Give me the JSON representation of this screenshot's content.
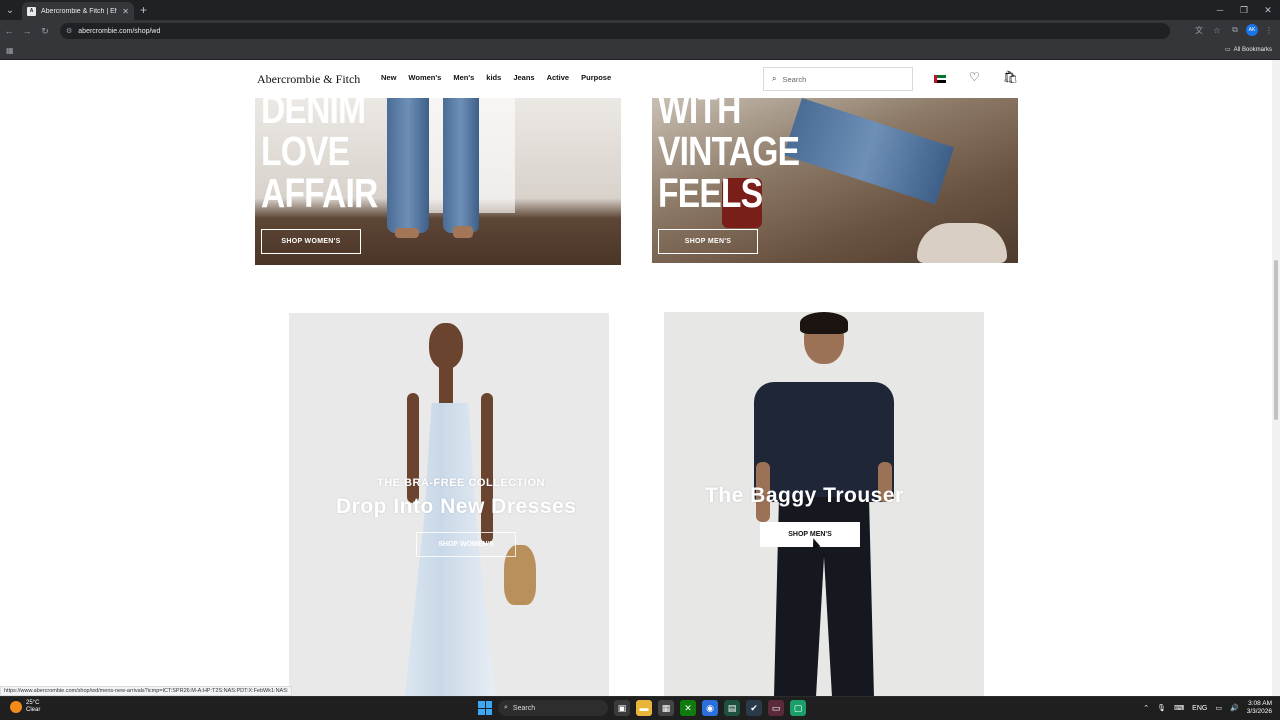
{
  "browser": {
    "tab_title": "Abercrombie & Fitch | Effortle...",
    "url": "abercrombie.com/shop/wd",
    "all_bookmarks": "All Bookmarks",
    "profile_initials": "AK"
  },
  "site": {
    "logo": "Abercrombie & Fitch",
    "nav": [
      "New",
      "Women's",
      "Men's",
      "kids",
      "Jeans",
      "Active",
      "Purpose"
    ],
    "search_placeholder": "Search"
  },
  "tiles": {
    "top_left": {
      "headline_lines": [
        "DENIM",
        "LOVE",
        "AFFAIR"
      ],
      "button": "SHOP WOMEN'S"
    },
    "top_right": {
      "headline_lines": [
        "WITH",
        "VINTAGE",
        "FEELS"
      ],
      "button": "SHOP MEN'S"
    },
    "bottom_left": {
      "kicker": "THE BRA-FREE COLLECTION",
      "title": "Drop Into New Dresses",
      "button": "SHOP WOMEN'S"
    },
    "bottom_right": {
      "title": "The Baggy Trouser",
      "button": "SHOP MEN'S"
    }
  },
  "status_bar_url": "https://www.abercrombie.com/shop/wd/mens-new-arrivals?icmp=ICT:SPR26:M-A:HP:T2S:NAS:PDT:X:FebWk1:NAS:",
  "taskbar": {
    "weather_temp": "25°C",
    "weather_desc": "Clear",
    "search": "Search",
    "lang": "ENG",
    "time": "3:08 AM",
    "date": "3/3/2026"
  },
  "colors": {
    "flag_red": "#c8102e",
    "flag_green": "#00732f",
    "flag_black": "#000000",
    "windows_blue": "#3ba7f5"
  }
}
